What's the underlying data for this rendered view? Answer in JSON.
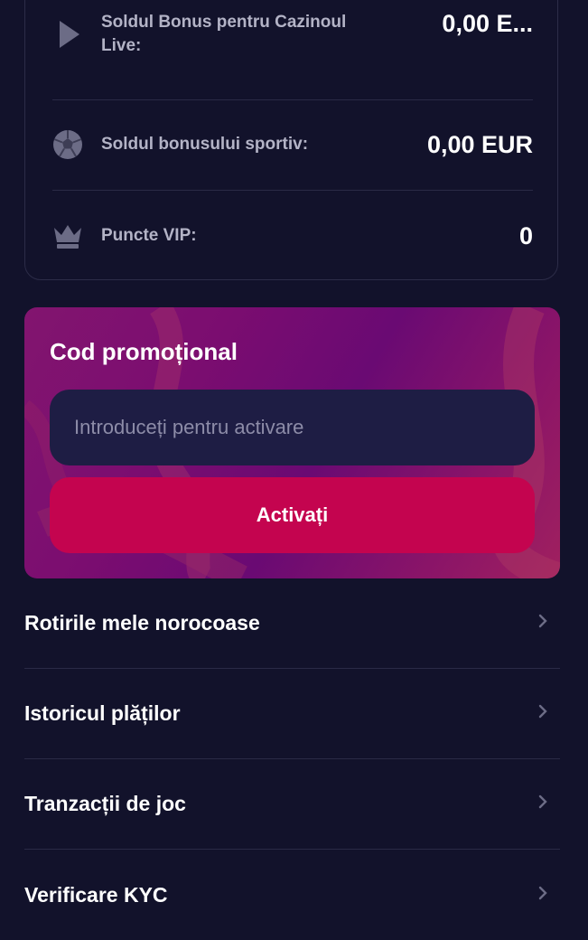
{
  "balances": [
    {
      "icon": "play-icon",
      "label_line1": "Soldul Bonus pentru Cazinoul",
      "label_line2": "Live:",
      "value": "0,00 E..."
    },
    {
      "icon": "soccer-ball-icon",
      "label_line1": "Soldul bonusului sportiv:",
      "value": "0,00 EUR"
    },
    {
      "icon": "crown-icon",
      "label_line1": "Puncte VIP:",
      "value": "0"
    }
  ],
  "promo": {
    "title": "Cod promoțional",
    "placeholder": "Introduceți pentru activare",
    "button": "Activați"
  },
  "menu": [
    {
      "label": "Rotirile mele norocoase"
    },
    {
      "label": "Istoricul plăților"
    },
    {
      "label": "Tranzacții de joc"
    },
    {
      "label": "Verificare KYC"
    }
  ],
  "colors": {
    "background": "#12122b",
    "accent": "#c4044f",
    "promo": "#7b0d70"
  }
}
